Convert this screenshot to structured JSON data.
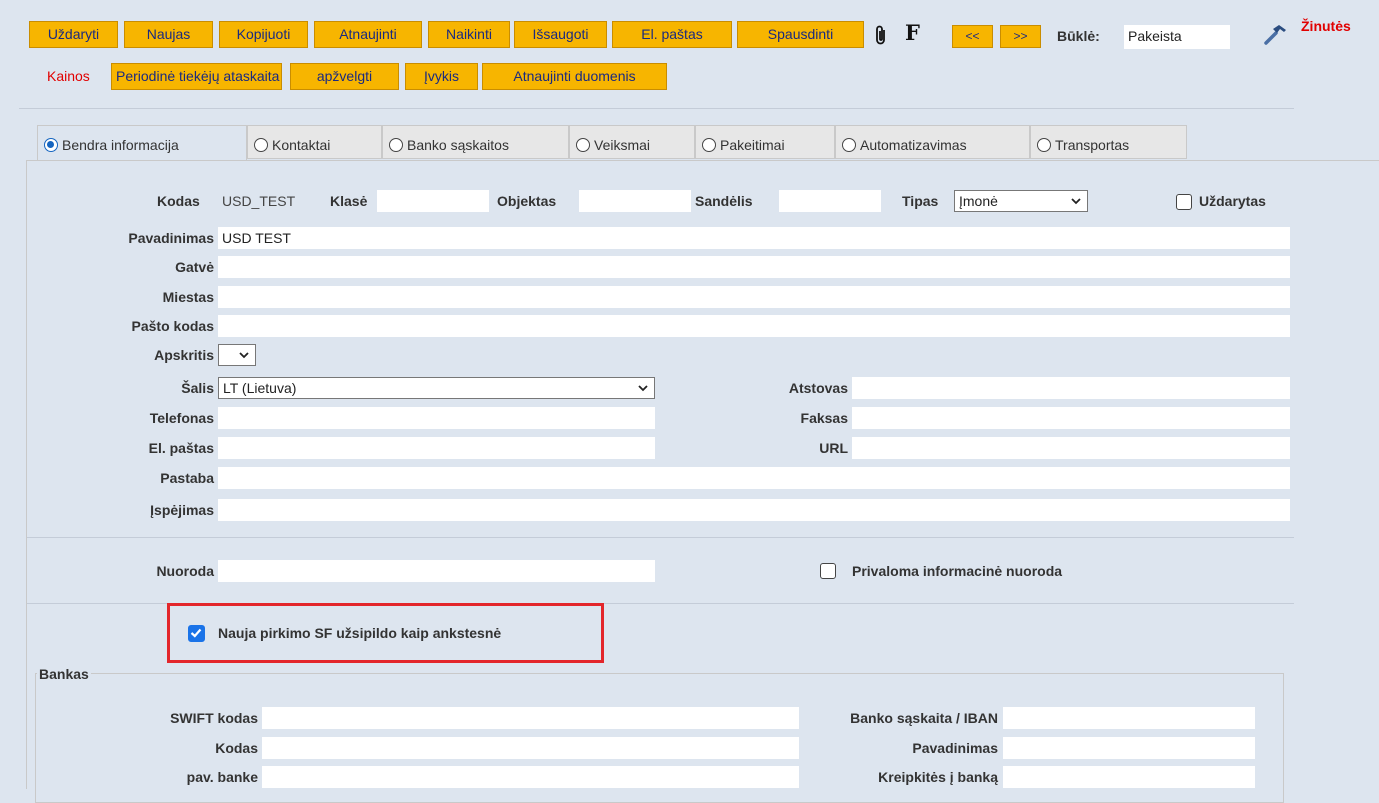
{
  "toolbar": {
    "buttons": [
      "Uždaryti",
      "Naujas",
      "Kopijuoti",
      "Atnaujinti",
      "Naikinti",
      "Išsaugoti",
      "El. paštas",
      "Spausdinti"
    ],
    "f_label": "F",
    "prev": "<<",
    "next": ">>",
    "status_label": "Būklė:",
    "status_value": "Pakeista",
    "messages": "Žinutės"
  },
  "toolbar2": {
    "kainos": "Kainos",
    "buttons": [
      "Periodinė tiekėjų ataskaita",
      "apžvelgti",
      "Įvykis",
      "Atnaujinti duomenis"
    ]
  },
  "tabs": [
    "Bendra informacija",
    "Kontaktai",
    "Banko sąskaitos",
    "Veiksmai",
    "Pakeitimai",
    "Automatizavimas",
    "Transportas"
  ],
  "form": {
    "kodas_label": "Kodas",
    "kodas_value": "USD_TEST",
    "klase_label": "Klasė",
    "klase_value": "",
    "objektas_label": "Objektas",
    "objektas_value": "",
    "sandelis_label": "Sandėlis",
    "sandelis_value": "",
    "tipas_label": "Tipas",
    "tipas_value": "Įmonė",
    "uzdarytas_label": "Uždarytas",
    "pavadinimas_label": "Pavadinimas",
    "pavadinimas_value": "USD TEST",
    "gatve_label": "Gatvė",
    "gatve_value": "",
    "miestas_label": "Miestas",
    "miestas_value": "",
    "pasto_kodas_label": "Pašto kodas",
    "pasto_kodas_value": "",
    "apskritis_label": "Apskritis",
    "apskritis_value": "",
    "salis_label": "Šalis",
    "salis_value": "LT (Lietuva)",
    "atstovas_label": "Atstovas",
    "atstovas_value": "",
    "telefonas_label": "Telefonas",
    "telefonas_value": "",
    "faksas_label": "Faksas",
    "faksas_value": "",
    "el_pastas_label": "El. paštas",
    "el_pastas_value": "",
    "url_label": "URL",
    "url_value": "",
    "pastaba_label": "Pastaba",
    "pastaba_value": "",
    "ispejimas_label": "Įspėjimas",
    "ispejimas_value": "",
    "nuoroda_label": "Nuoroda",
    "nuoroda_value": "",
    "privaloma_label": "Privaloma informacinė nuoroda",
    "nauja_label": "Nauja pirkimo SF užsipildo kaip ankstesnė",
    "nauja_checked": true
  },
  "bank": {
    "legend": "Bankas",
    "swift_label": "SWIFT kodas",
    "swift_value": "",
    "iban_label": "Banko sąskaita / IBAN",
    "iban_value": "",
    "kodas_label": "Kodas",
    "kodas_value": "",
    "pavadinimas_label": "Pavadinimas",
    "pavadinimas_value": "",
    "pav_banke_label": "pav. banke",
    "pav_banke_value": "",
    "kreipkites_label": "Kreipkitės į banką",
    "kreipkites_value": ""
  },
  "colors": {
    "button": "#f7b500",
    "button_text": "#1a2a80",
    "highlight": "#e3262b",
    "accent": "#1a73e8"
  }
}
